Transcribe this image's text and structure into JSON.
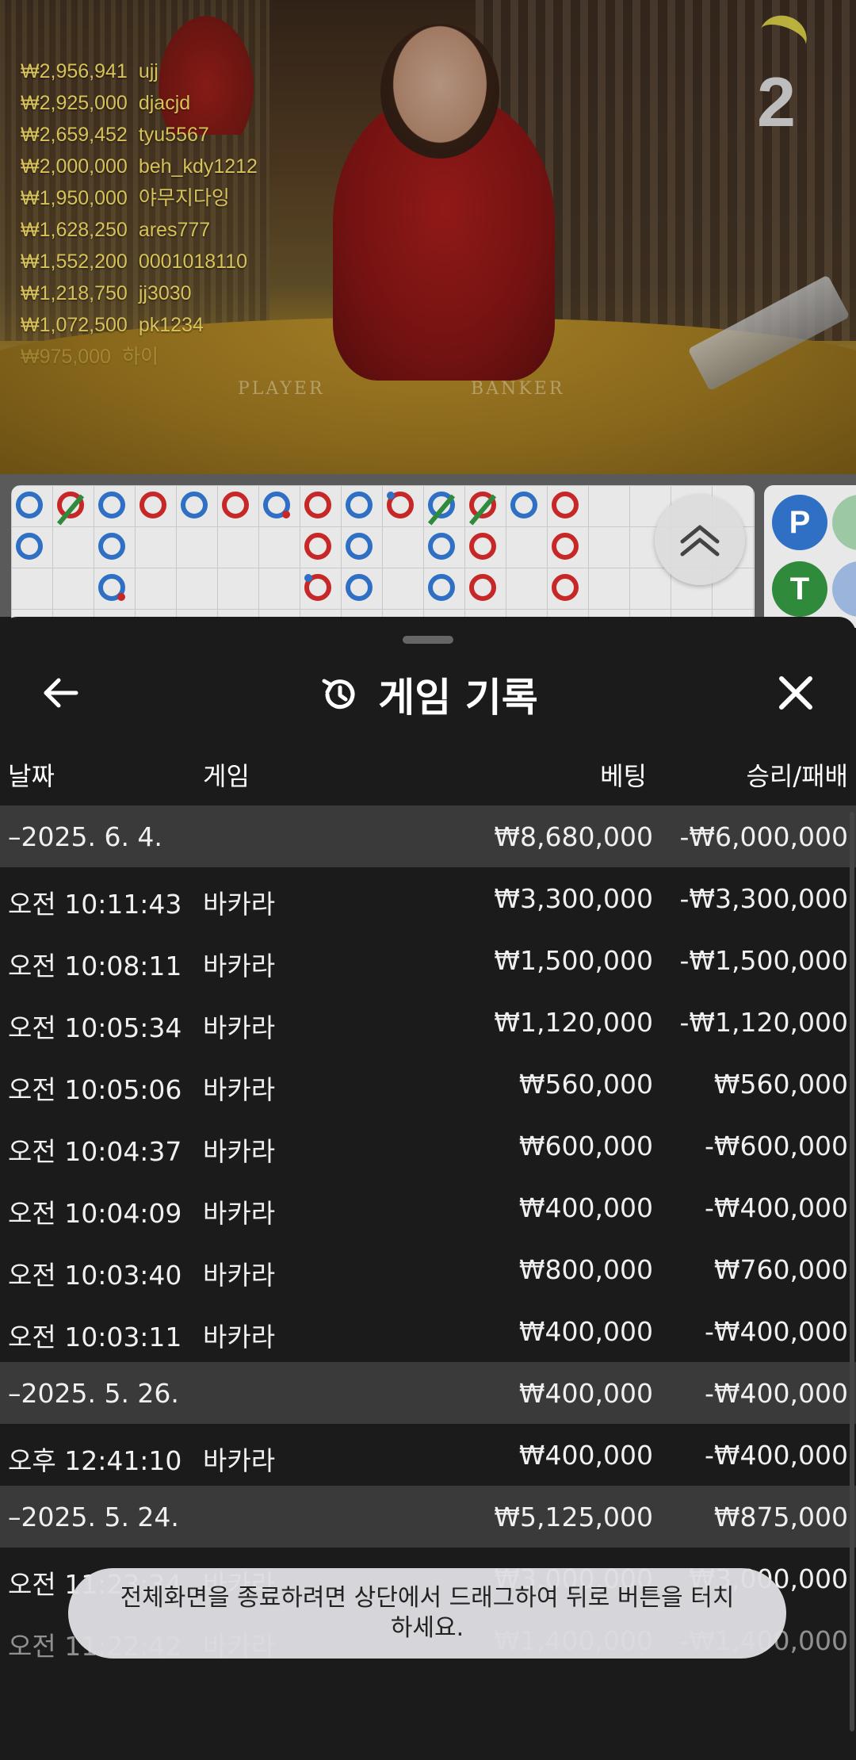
{
  "video": {
    "round_number": "2",
    "table_labels": {
      "player": "PLAYER",
      "banker": "BANKER"
    },
    "winners": [
      {
        "amount": "₩2,956,941",
        "name": "ujj"
      },
      {
        "amount": "₩2,925,000",
        "name": "djacjd"
      },
      {
        "amount": "₩2,659,452",
        "name": "tyu5567"
      },
      {
        "amount": "₩2,000,000",
        "name": "beh_kdy1212"
      },
      {
        "amount": "₩1,950,000",
        "name": "야무지다잉"
      },
      {
        "amount": "₩1,628,250",
        "name": "ares777"
      },
      {
        "amount": "₩1,552,200",
        "name": "0001018110"
      },
      {
        "amount": "₩1,218,750",
        "name": "jj3030"
      },
      {
        "amount": "₩1,072,500",
        "name": "pk1234"
      },
      {
        "amount": "₩975,000",
        "name": "하이"
      }
    ]
  },
  "roadmap": {
    "stats": {
      "player": "P",
      "tie": "T"
    },
    "colors": {
      "banker": "#c62828",
      "player": "#2f6fc4",
      "tie": "#2f8a3c"
    }
  },
  "sheet": {
    "title": "게임 기록",
    "icons": {
      "back": "arrow-left-icon",
      "history": "history-icon",
      "close": "close-icon"
    },
    "columns": {
      "date": "날짜",
      "game": "게임",
      "bet": "베팅",
      "win_loss": "승리/패배"
    },
    "rows": [
      {
        "type": "group",
        "date": "–2025. 6. 4.",
        "game": "",
        "bet": "₩8,680,000",
        "win_loss": "-₩6,000,000"
      },
      {
        "type": "item",
        "date": "오전 10:11:43",
        "game": "바카라",
        "bet": "₩3,300,000",
        "win_loss": "-₩3,300,000"
      },
      {
        "type": "item",
        "date": "오전 10:08:11",
        "game": "바카라",
        "bet": "₩1,500,000",
        "win_loss": "-₩1,500,000"
      },
      {
        "type": "item",
        "date": "오전 10:05:34",
        "game": "바카라",
        "bet": "₩1,120,000",
        "win_loss": "-₩1,120,000"
      },
      {
        "type": "item",
        "date": "오전 10:05:06",
        "game": "바카라",
        "bet": "₩560,000",
        "win_loss": "₩560,000"
      },
      {
        "type": "item",
        "date": "오전 10:04:37",
        "game": "바카라",
        "bet": "₩600,000",
        "win_loss": "-₩600,000"
      },
      {
        "type": "item",
        "date": "오전 10:04:09",
        "game": "바카라",
        "bet": "₩400,000",
        "win_loss": "-₩400,000"
      },
      {
        "type": "item",
        "date": "오전 10:03:40",
        "game": "바카라",
        "bet": "₩800,000",
        "win_loss": "₩760,000"
      },
      {
        "type": "item",
        "date": "오전 10:03:11",
        "game": "바카라",
        "bet": "₩400,000",
        "win_loss": "-₩400,000"
      },
      {
        "type": "group",
        "date": "–2025. 5. 26.",
        "game": "",
        "bet": "₩400,000",
        "win_loss": "-₩400,000"
      },
      {
        "type": "item",
        "date": "오후 12:41:10",
        "game": "바카라",
        "bet": "₩400,000",
        "win_loss": "-₩400,000"
      },
      {
        "type": "group",
        "date": "–2025. 5. 24.",
        "game": "",
        "bet": "₩5,125,000",
        "win_loss": "₩875,000"
      },
      {
        "type": "item",
        "date": "오전 11:23:34",
        "game": "바카라",
        "bet": "₩3,000,000",
        "win_loss": "₩3,000,000"
      },
      {
        "type": "item",
        "date": "오전 11:22:42",
        "game": "바카라",
        "bet": "₩1,400,000",
        "win_loss": "-₩1,400,000"
      }
    ]
  },
  "toast": {
    "message": "전체화면을 종료하려면 상단에서 드래그하여 뒤로 버튼을 터치하세요."
  }
}
